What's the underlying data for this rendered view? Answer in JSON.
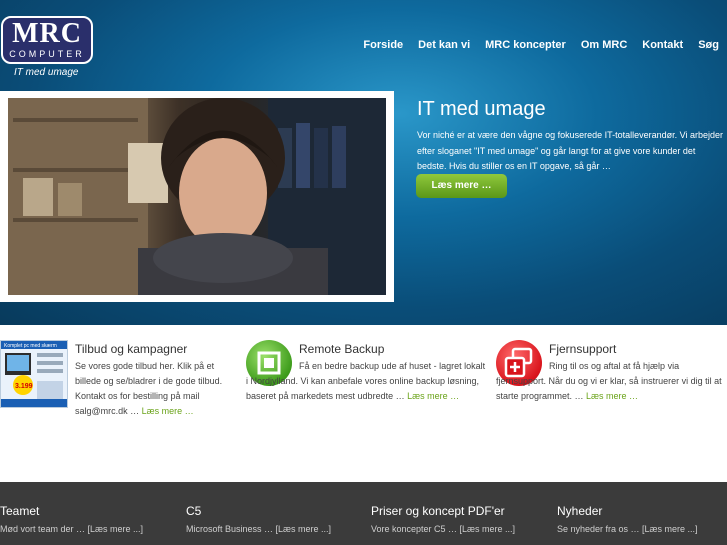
{
  "brand": {
    "name": "MRC",
    "subtitle": "COMPUTER",
    "tagline": "IT med umage"
  },
  "nav": {
    "items": [
      "Forside",
      "Det kan vi",
      "MRC koncepter",
      "Om MRC",
      "Kontakt",
      "Søg"
    ]
  },
  "hero": {
    "headline": "IT med umage",
    "text": "Vor niché er at være den vågne og fokuserede IT-totalleverandør. Vi arbejder efter sloganet \"IT med umage\" og går langt for at give vore kunder det bedste. Hvis du stiller os en IT opgave, så går …",
    "button": "Læs mere …"
  },
  "features": [
    {
      "title": "Tilbud og kampagner",
      "text": "Se vores gode tilbud her. Klik på et billede og se/bladrer i de gode tilbud. Kontakt os for bestilling på mail salg@mrc.dk …",
      "more": "Læs mere …",
      "icon": "flyer-thumbnail",
      "thumb": {
        "headline": "Komplet pc med skærm",
        "price": "3.199"
      }
    },
    {
      "title": "Remote Backup",
      "text": "Få en bedre backup ude af huset - lagret lokalt i Nordjylland. Vi kan anbefale vores online backup løsning, baseret på markedets mest udbredte …",
      "more": "Læs mere …",
      "icon": "backup-icon"
    },
    {
      "title": "Fjernsupport",
      "text": "Ring til os og aftal at få hjælp via fjernsupport. Når du og vi er klar, så instruerer vi dig til at starte programmet. …",
      "more": "Læs mere …",
      "icon": "remote-support-icon"
    }
  ],
  "footer": [
    {
      "title": "Teamet",
      "text": "Mød vort team der … [Læs mere ...]"
    },
    {
      "title": "C5",
      "text": "Microsoft Business … [Læs mere ...]"
    },
    {
      "title": "Priser og koncept PDF'er",
      "text": "Vore koncepter C5 … [Læs mere ...]"
    },
    {
      "title": "Nyheder",
      "text": "Se nyheder fra os … [Læs mere ...]"
    }
  ],
  "colors": {
    "hero_blue": "#0e6a9e",
    "button_green": "#6aa319",
    "logo_navy": "#2a2f6b",
    "footer": "#3b3b3b"
  }
}
